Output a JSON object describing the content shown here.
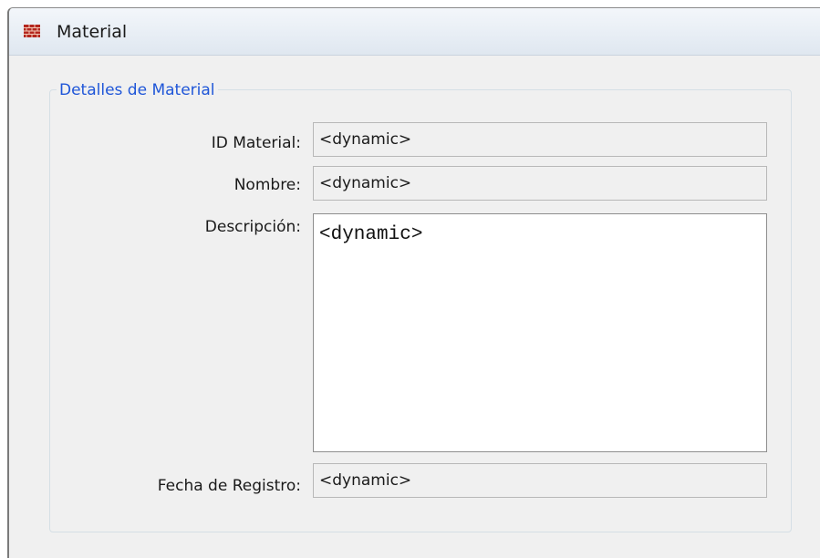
{
  "window": {
    "title": "Material"
  },
  "group": {
    "legend": "Detalles de Material"
  },
  "fields": {
    "id_label": "ID Material:",
    "id_value": "<dynamic>",
    "nombre_label": "Nombre:",
    "nombre_value": "<dynamic>",
    "descripcion_label": "Descripción:",
    "descripcion_value": "<dynamic>",
    "fecha_label": "Fecha de Registro:",
    "fecha_value": "<dynamic>"
  },
  "colors": {
    "legend": "#1f56d8",
    "window_bg": "#f0f0f0",
    "icon": "#c0392b"
  },
  "icons": {
    "window_icon": "brick-wall-icon"
  }
}
